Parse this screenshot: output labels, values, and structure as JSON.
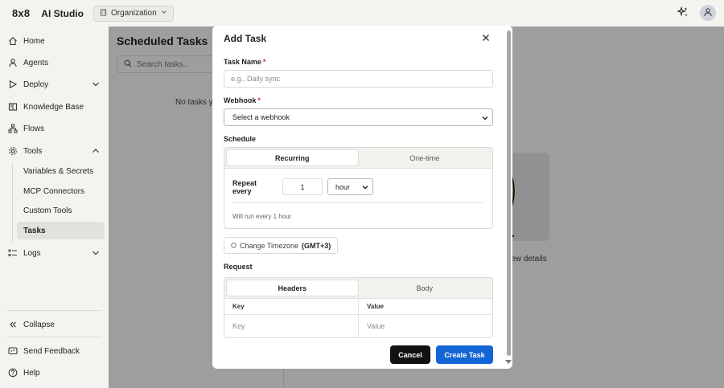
{
  "topbar": {
    "logo": "8x8",
    "app_name": "AI Studio",
    "org_label": "Organization",
    "icons": [
      "building-icon",
      "chevron-down-icon",
      "sparkle-icon",
      "user-icon"
    ]
  },
  "sidebar": {
    "items": [
      {
        "label": "Home",
        "icon": "home-icon"
      },
      {
        "label": "Agents",
        "icon": "person-icon"
      },
      {
        "label": "Deploy",
        "icon": "play-icon"
      },
      {
        "label": "Knowledge Base",
        "icon": "book-icon"
      },
      {
        "label": "Flows",
        "icon": "flow-icon"
      },
      {
        "label": "Tools",
        "icon": "gear-icon"
      }
    ],
    "tools_subitems": [
      "Variables & Secrets",
      "MCP Connectors",
      "Custom Tools",
      "Tasks"
    ],
    "active_subitem": "Tasks",
    "logs_label": "Logs",
    "collapse_label": "Collapse",
    "feedback_label": "Send Feedback",
    "help_label": "Help"
  },
  "main": {
    "title": "Scheduled Tasks",
    "search_placeholder": "Search tasks...",
    "empty_text": "No tasks y",
    "view_details": "view details"
  },
  "modal": {
    "title": "Add Task",
    "task_name": {
      "label": "Task Name",
      "required": "*",
      "placeholder": "e.g., Daily sync"
    },
    "webhook": {
      "label": "Webhook",
      "required": "*",
      "selected": "Select a webhook"
    },
    "schedule": {
      "label": "Schedule",
      "tabs": [
        "Recurring",
        "One-time"
      ],
      "active_tab": "Recurring",
      "repeat_label": "Repeat every",
      "repeat_value": "1",
      "unit": "hour",
      "hint": "Will run every 1 hour"
    },
    "timezone": {
      "label": "Change Timezone",
      "value": "(GMT+3)"
    },
    "request": {
      "label": "Request",
      "tabs": [
        "Headers",
        "Body"
      ],
      "active_tab": "Headers",
      "columns": [
        "Key",
        "Value"
      ],
      "key_placeholder": "Key",
      "value_placeholder": "Value"
    },
    "cancel_label": "Cancel",
    "create_label": "Create Task"
  },
  "colors": {
    "primary": "#1366d6",
    "cancel_bg": "#111111",
    "required": "#d32f2f",
    "overlay": "rgba(0,0,0,0.38)"
  }
}
